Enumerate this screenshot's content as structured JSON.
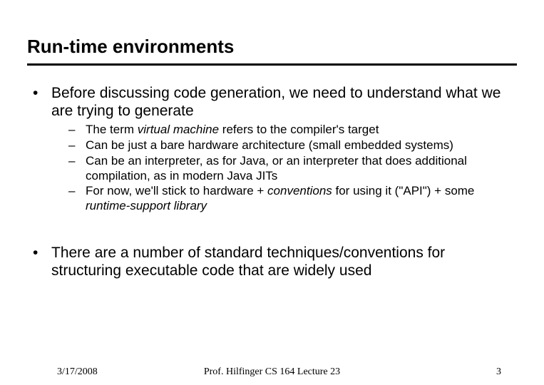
{
  "title": "Run-time environments",
  "bullets": [
    {
      "text": "Before discussing code generation, we need to understand what we are trying to generate",
      "sub": [
        {
          "pre": "The term ",
          "em": "virtual machine",
          "post": " refers to the compiler's target"
        },
        {
          "pre": "Can be just a bare hardware architecture (small embedded systems)",
          "em": "",
          "post": ""
        },
        {
          "pre": "Can be an interpreter, as for Java, or an interpreter that does additional compilation, as in modern Java JITs",
          "em": "",
          "post": ""
        },
        {
          "pre": "For now, we'll stick to hardware + ",
          "em": "conventions",
          "post": " for using it (\"API\") + some ",
          "em2": "runtime-support library",
          "post2": ""
        }
      ]
    },
    {
      "text": "There are a number of standard techniques/conventions for structuring executable code that are widely used",
      "sub": []
    }
  ],
  "footer": {
    "date": "3/17/2008",
    "center": "Prof. Hilfinger  CS 164  Lecture 23",
    "page": "3"
  }
}
